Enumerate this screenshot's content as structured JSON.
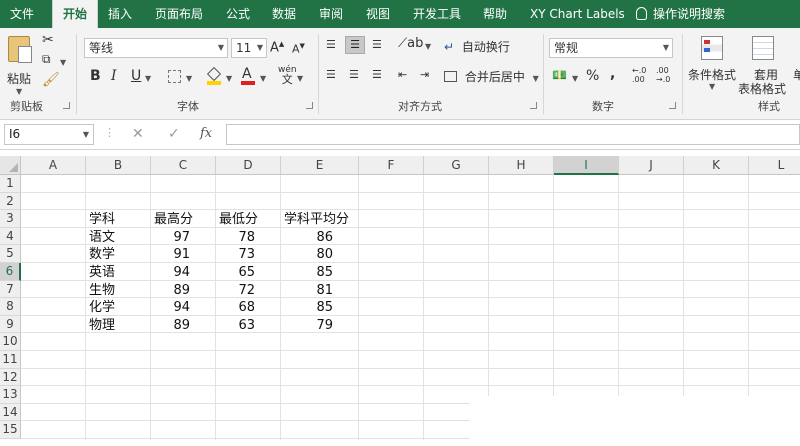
{
  "tabs": [
    {
      "label": "文件",
      "active": false
    },
    {
      "label": "开始",
      "active": true
    },
    {
      "label": "插入",
      "active": false
    },
    {
      "label": "页面布局",
      "active": false
    },
    {
      "label": "公式",
      "active": false
    },
    {
      "label": "数据",
      "active": false
    },
    {
      "label": "审阅",
      "active": false
    },
    {
      "label": "视图",
      "active": false
    },
    {
      "label": "开发工具",
      "active": false
    },
    {
      "label": "帮助",
      "active": false
    },
    {
      "label": "XY Chart Labels",
      "active": false
    },
    {
      "label": "操作说明搜索",
      "active": false
    }
  ],
  "ribbon": {
    "clipboard": {
      "label": "剪贴板",
      "paste": "粘贴"
    },
    "font": {
      "label": "字体",
      "name": "等线",
      "size": "11"
    },
    "alignment": {
      "label": "对齐方式",
      "wrap": "自动换行",
      "merge": "合并后居中"
    },
    "number": {
      "label": "数字",
      "format": "常规"
    },
    "styles": {
      "label": "样式",
      "conditional": "条件格式",
      "table_line1": "套用",
      "table_line2": "表格格式",
      "cut_off": "单"
    }
  },
  "formula_bar": {
    "name_box": "I6",
    "fx": "fx",
    "value": ""
  },
  "columns": [
    "A",
    "B",
    "C",
    "D",
    "E",
    "F",
    "G",
    "H",
    "I",
    "J",
    "K",
    "L"
  ],
  "selected_column": "I",
  "rows": [
    "1",
    "2",
    "3",
    "4",
    "5",
    "6",
    "7",
    "8",
    "9",
    "10",
    "11",
    "12",
    "13",
    "14",
    "15"
  ],
  "selected_row": "6",
  "table": {
    "headers": [
      "学科",
      "最高分",
      "最低分",
      "学科平均分"
    ],
    "rows": [
      [
        "语文",
        "97",
        "78",
        "86"
      ],
      [
        "数学",
        "91",
        "73",
        "80"
      ],
      [
        "英语",
        "94",
        "65",
        "85"
      ],
      [
        "生物",
        "89",
        "72",
        "81"
      ],
      [
        "化学",
        "94",
        "68",
        "85"
      ],
      [
        "物理",
        "89",
        "63",
        "79"
      ]
    ]
  },
  "colors": {
    "accent": "#217346",
    "ribbon_bg": "#f3f3f3",
    "header_bg": "#efefef"
  }
}
